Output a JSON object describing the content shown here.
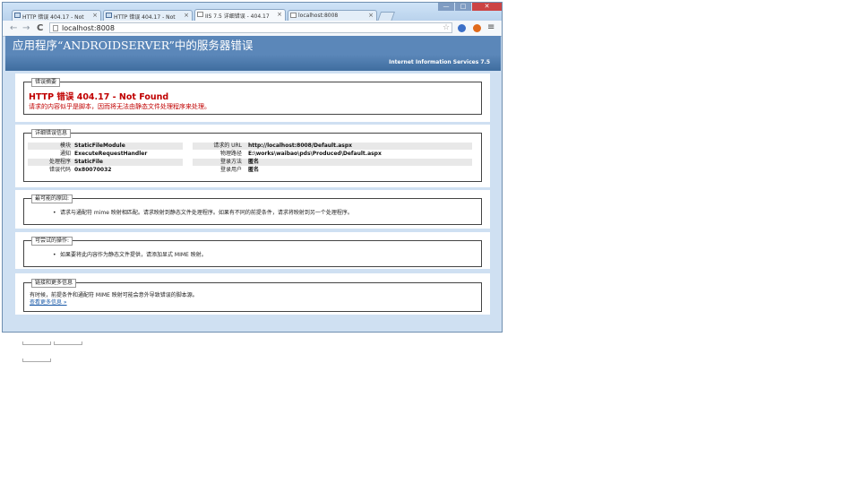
{
  "tabs": [
    {
      "label": "HTTP 错误 404.17 - Not",
      "active": false
    },
    {
      "label": "HTTP 错误 404.17 - Not",
      "active": false
    },
    {
      "label": "IIS 7.5 详细错误 - 404.17",
      "active": true
    },
    {
      "label": "localhost:8008",
      "active": false
    }
  ],
  "window_controls": {
    "minimize": "—",
    "maximize": "□",
    "close": "✕"
  },
  "toolbar": {
    "back": "←",
    "forward": "→",
    "reload": "C",
    "address": "localhost:8008",
    "star": "☆",
    "menu": "≡"
  },
  "page": {
    "header_title": "应用程序“ANDROIDSERVER”中的服务器错误",
    "server_name": "Internet Information Services 7.5",
    "summary": {
      "legend": "错误摘要",
      "title": "HTTP 错误 404.17 - Not Found",
      "message": "请求的内容似乎是脚本，因而将无法由静态文件处理程序来处理。"
    },
    "details": {
      "legend": "详细错误信息",
      "left": [
        {
          "label": "模块",
          "value": "StaticFileModule"
        },
        {
          "label": "通知",
          "value": "ExecuteRequestHandler"
        },
        {
          "label": "处理程序",
          "value": "StaticFile"
        },
        {
          "label": "错误代码",
          "value": "0x80070032"
        }
      ],
      "right": [
        {
          "label": "请求的 URL",
          "value": "http://localhost:8008/Default.aspx"
        },
        {
          "label": "物理路径",
          "value": "E:\\works\\waibao\\pds\\Produced\\Default.aspx"
        },
        {
          "label": "登录方法",
          "value": "匿名"
        },
        {
          "label": "登录用户",
          "value": "匿名"
        }
      ]
    },
    "causes": {
      "legend": "最可能的原因:",
      "items": [
        "请求与通配符 mime 映射相匹配。请求映射到静态文件处理程序。如果有不同的前提条件，请求将映射到另一个处理程序。"
      ]
    },
    "actions": {
      "legend": "可尝试的操作:",
      "items": [
        "如果要将此内容作为静态文件提供，请添加显式 MIME 映射。"
      ]
    },
    "links": {
      "legend": "链接和更多信息",
      "text": "有时候，前提条件和通配符 MIME 映射可能会意外导致错误的脚本源。",
      "link_label": "查看更多信息 »"
    }
  }
}
